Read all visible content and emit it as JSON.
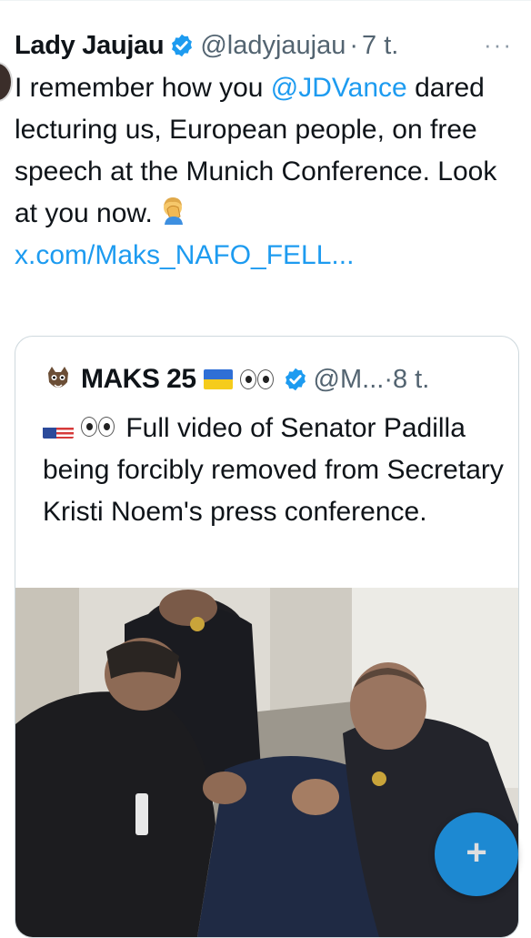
{
  "tweet": {
    "author_name": "Lady Jaujau",
    "handle": "@ladyjaujau",
    "separator": "·",
    "time": "7 t.",
    "more": "···",
    "text_before": "I remember how you ",
    "mention": "@JDVance",
    "text_after": " dared lecturing us, European people, on free speech at the Munich Conference. Look at you now. ",
    "link": "x.com/Maks_NAFO_FELL..."
  },
  "quote": {
    "author_name": "MAKS 25",
    "handle": "@M...",
    "separator": "·",
    "time": "8 t.",
    "text": "Full video of Senator Padilla being forcibly removed from Secretary Kristi Noem's press conference."
  },
  "fab": {
    "label": "+"
  },
  "icons": {
    "verified": "verified-badge-icon",
    "facepalm": "facepalm-emoji-icon",
    "eyes": "eyes-emoji-icon",
    "ukraine_flag": "ukraine-flag-icon",
    "us_flag": "us-flag-icon",
    "compose": "plus-icon"
  },
  "colors": {
    "accent": "#1d9bf0",
    "secondary_text": "#536471",
    "border": "#cfd9de"
  }
}
